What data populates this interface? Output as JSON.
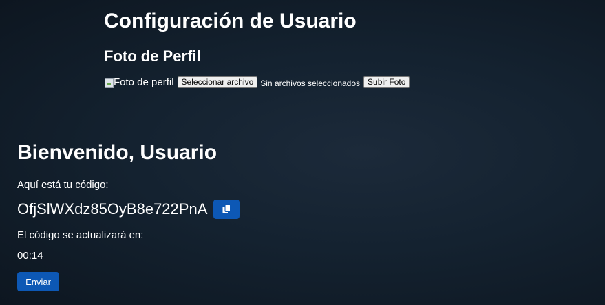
{
  "settings": {
    "title": "Configuración de Usuario",
    "profile_section_title": "Foto de Perfil",
    "avatar_alt": "Foto de perfil",
    "choose_file_label": "Seleccionar archivo",
    "no_file_text": "Sin archivos seleccionados",
    "upload_label": "Subir Foto"
  },
  "welcome": {
    "title": "Bienvenido, Usuario",
    "code_label": "Aquí está tu código:",
    "code_value": "OfjSlWXdz85OyB8e722PnA",
    "copy_icon": "copy-icon",
    "refresh_label": "El código se actualizará en:",
    "timer": "00:14",
    "send_label": "Enviar"
  },
  "colors": {
    "primary_button": "#0d58b5",
    "background": "#142230",
    "text": "#ffffff"
  }
}
